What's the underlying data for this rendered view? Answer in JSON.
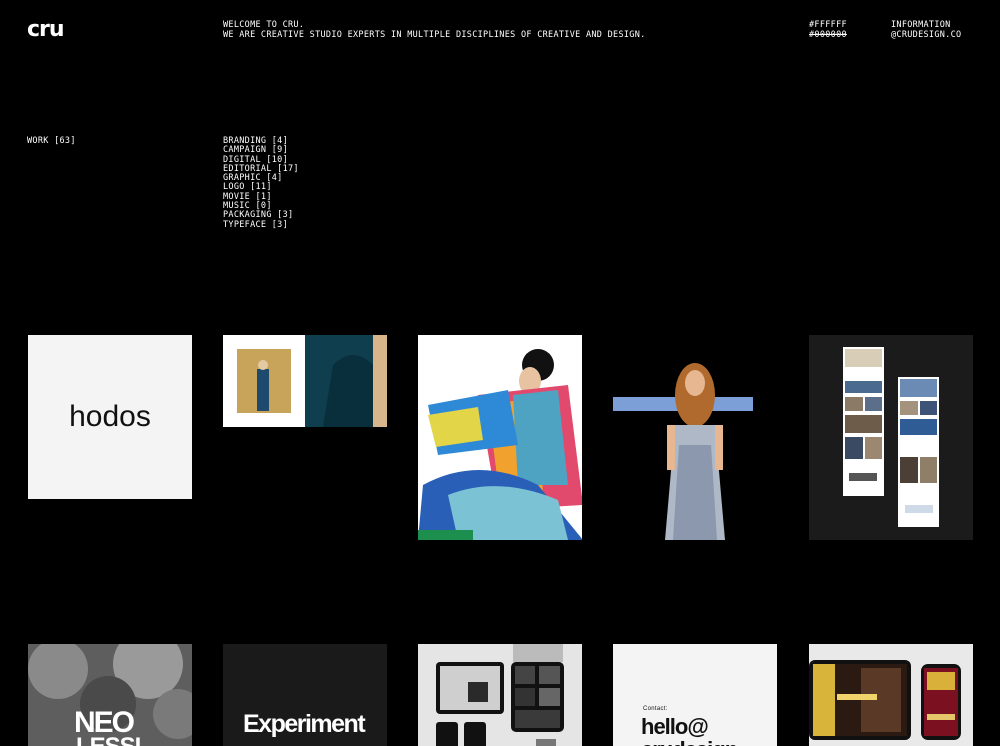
{
  "header": {
    "logo": "cru",
    "intro_line1": "WELCOME TO CRU.",
    "intro_line2": "WE ARE CREATIVE STUDIO EXPERTS IN MULTIPLE DISCIPLINES OF CREATIVE AND DESIGN.",
    "color_light": "#FFFFFF",
    "color_dark": "#000000",
    "info_label": "INFORMATION",
    "info_email": "@CRUDESIGN.CO"
  },
  "filters": {
    "work": "WORK [63]",
    "categories": [
      "BRANDING [4]",
      "CAMPAIGN [9]",
      "DIGITAL [10]",
      "EDITORIAL [17]",
      "GRAPHIC [4]",
      "LOGO [11]",
      "MOVIE [1]",
      "MUSIC [0]",
      "PACKAGING [3]",
      "TYPEFACE [3]"
    ]
  },
  "projects": {
    "hodos": "hodos",
    "neo_line1": "NEO",
    "neo_line2": "LESSI",
    "experiment": "Experiment",
    "hello_small": "Contact:",
    "hello_line1": "hello@",
    "hello_line2": "crudesign"
  },
  "colors": {
    "background": "#000000",
    "text": "#ffffff",
    "tile_light": "#f4f4f4",
    "accent_blue": "#7b9fd6"
  }
}
